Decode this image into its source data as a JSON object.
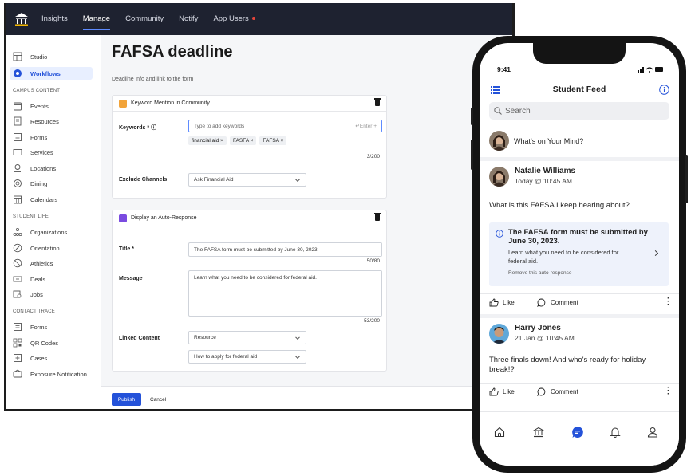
{
  "desktop": {
    "topnav": {
      "items": [
        "Insights",
        "Manage",
        "Community",
        "Notify",
        "App Users"
      ],
      "active": "Manage"
    },
    "sidebar": {
      "top_items": [
        "Studio",
        "Workflows"
      ],
      "campus_heading": "CAMPUS CONTENT",
      "campus_items": [
        "Events",
        "Resources",
        "Forms",
        "Services",
        "Locations",
        "Dining",
        "Calendars"
      ],
      "student_heading": "STUDENT LIFE",
      "student_items": [
        "Organizations",
        "Orientation",
        "Athletics",
        "Deals",
        "Jobs"
      ],
      "trace_heading": "CONTACT TRACE",
      "trace_items": [
        "Forms",
        "QR Codes",
        "Cases",
        "Exposure Notification"
      ]
    },
    "page": {
      "title": "FAFSA deadline",
      "subtitle": "Deadline info and link to the form"
    },
    "keyword_card": {
      "header": "Keyword Mention in Community",
      "keywords_label": "Keywords * ⓘ",
      "keywords_placeholder": "Type to add keywords",
      "enter_hint": "↵Enter +",
      "chips": [
        "financial aid ×",
        "FASFA ×",
        "FAFSA ×"
      ],
      "keywords_counter": "3/200",
      "exclude_label": "Exclude Channels",
      "exclude_value": "Ask Financial Aid"
    },
    "response_card": {
      "header": "Display an Auto-Response",
      "title_label": "Title *",
      "title_value": "The FAFSA form must be submitted by June 30, 2023.",
      "title_counter": "50/80",
      "message_label": "Message",
      "message_value": "Learn what you need to be considered for federal aid.",
      "message_counter": "53/200",
      "linked_label": "Linked Content",
      "linked_type": "Resource",
      "linked_value": "How to apply for federal aid"
    },
    "footer": {
      "publish": "Publish",
      "cancel": "Cancel"
    },
    "colors": {
      "nav_bg": "#1e2230",
      "accent": "#2452d9"
    }
  },
  "phone": {
    "status_time": "9:41",
    "header_title": "Student Feed",
    "search_placeholder": "Search",
    "compose_prompt": "What's on Your Mind?",
    "post1": {
      "author": "Natalie Williams",
      "time": "Today @ 10:45 AM",
      "text": "What is this FAFSA I keep hearing about?",
      "auto_title": "The FAFSA form must be submitted by June 30, 2023.",
      "auto_body": "Learn what you need to be considered for federal aid.",
      "auto_remove": "Remove this auto-response",
      "like": "Like",
      "comment": "Comment"
    },
    "post2": {
      "author": "Harry Jones",
      "time": "21 Jan @ 10:45 AM",
      "text": "Three finals down! And who's ready for holiday break!?",
      "like": "Like",
      "comment": "Comment"
    },
    "tabbar_icons": [
      "home-icon",
      "campus-icon",
      "feed-icon",
      "bell-icon",
      "profile-icon"
    ]
  }
}
